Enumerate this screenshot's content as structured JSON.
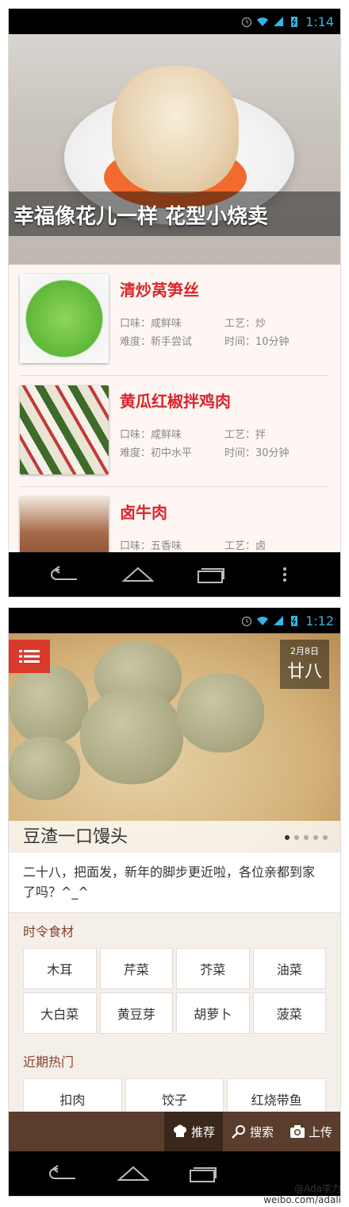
{
  "frame1": {
    "status": {
      "time": "1:14"
    },
    "hero": {
      "caption": "幸福像花儿一样 花型小烧卖"
    },
    "recipes": [
      {
        "title": "清炒莴笋丝",
        "taste_label": "口味：",
        "taste": "咸鲜味",
        "craft_label": "工艺：",
        "craft": "炒",
        "difficulty_label": "难度：",
        "difficulty": "新手尝试",
        "time_label": "时间：",
        "time": "10分钟"
      },
      {
        "title": "黄瓜红椒拌鸡肉",
        "taste_label": "口味：",
        "taste": "咸鲜味",
        "craft_label": "工艺：",
        "craft": "拌",
        "difficulty_label": "难度：",
        "difficulty": "初中水平",
        "time_label": "时间：",
        "time": "30分钟"
      },
      {
        "title": "卤牛肉",
        "taste_label": "口味：",
        "taste": "五香味",
        "craft_label": "工艺：",
        "craft": "卤",
        "difficulty_label": "",
        "difficulty": "",
        "time_label": "",
        "time": ""
      }
    ]
  },
  "frame2": {
    "status": {
      "time": "1:12"
    },
    "hero": {
      "date_small": "2月8日",
      "date_big": "廿八",
      "caption": "豆渣一口馒头",
      "dots_total": 5,
      "dots_active": 0
    },
    "intro": "二十八，把面发，新年的脚步更近啦，各位亲都到家了吗？^_^",
    "seasonal": {
      "title": "时令食材",
      "items": [
        "木耳",
        "芹菜",
        "芥菜",
        "油菜",
        "大白菜",
        "黄豆芽",
        "胡萝卜",
        "菠菜"
      ]
    },
    "hot": {
      "title": "近期热门",
      "items": [
        "扣肉",
        "饺子",
        "红烧带鱼"
      ]
    },
    "tabs": [
      {
        "label": "推荐",
        "icon": "chef-hat-icon",
        "active": true
      },
      {
        "label": "搜索",
        "icon": "search-icon",
        "active": false
      },
      {
        "label": "上传",
        "icon": "camera-icon",
        "active": false
      }
    ]
  },
  "watermark": {
    "line1": "@Ada李力",
    "line2": "weibo.com/adali"
  },
  "colors": {
    "accent_red": "#d9262b",
    "status_blue": "#33b5e5",
    "tabbar_brown": "#5a3d2d",
    "section_title": "#8a3f2e"
  }
}
